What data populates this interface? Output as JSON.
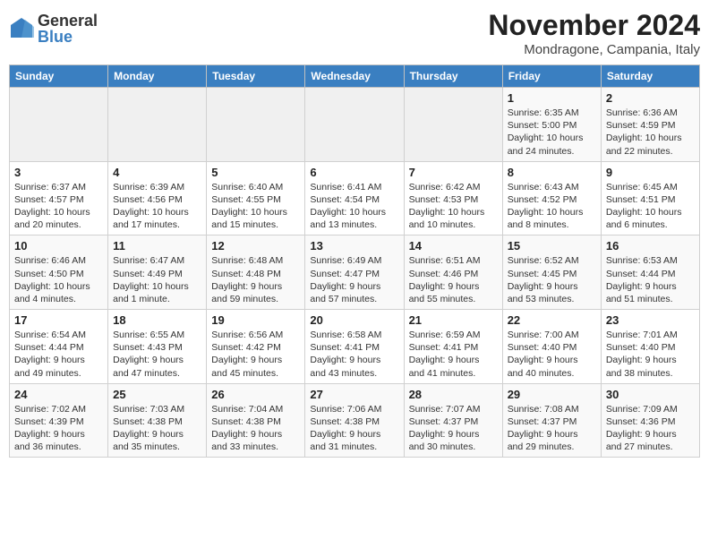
{
  "logo": {
    "general": "General",
    "blue": "Blue"
  },
  "title": "November 2024",
  "location": "Mondragone, Campania, Italy",
  "days_of_week": [
    "Sunday",
    "Monday",
    "Tuesday",
    "Wednesday",
    "Thursday",
    "Friday",
    "Saturday"
  ],
  "weeks": [
    [
      {
        "day": "",
        "info": ""
      },
      {
        "day": "",
        "info": ""
      },
      {
        "day": "",
        "info": ""
      },
      {
        "day": "",
        "info": ""
      },
      {
        "day": "",
        "info": ""
      },
      {
        "day": "1",
        "info": "Sunrise: 6:35 AM\nSunset: 5:00 PM\nDaylight: 10 hours and 24 minutes."
      },
      {
        "day": "2",
        "info": "Sunrise: 6:36 AM\nSunset: 4:59 PM\nDaylight: 10 hours and 22 minutes."
      }
    ],
    [
      {
        "day": "3",
        "info": "Sunrise: 6:37 AM\nSunset: 4:57 PM\nDaylight: 10 hours and 20 minutes."
      },
      {
        "day": "4",
        "info": "Sunrise: 6:39 AM\nSunset: 4:56 PM\nDaylight: 10 hours and 17 minutes."
      },
      {
        "day": "5",
        "info": "Sunrise: 6:40 AM\nSunset: 4:55 PM\nDaylight: 10 hours and 15 minutes."
      },
      {
        "day": "6",
        "info": "Sunrise: 6:41 AM\nSunset: 4:54 PM\nDaylight: 10 hours and 13 minutes."
      },
      {
        "day": "7",
        "info": "Sunrise: 6:42 AM\nSunset: 4:53 PM\nDaylight: 10 hours and 10 minutes."
      },
      {
        "day": "8",
        "info": "Sunrise: 6:43 AM\nSunset: 4:52 PM\nDaylight: 10 hours and 8 minutes."
      },
      {
        "day": "9",
        "info": "Sunrise: 6:45 AM\nSunset: 4:51 PM\nDaylight: 10 hours and 6 minutes."
      }
    ],
    [
      {
        "day": "10",
        "info": "Sunrise: 6:46 AM\nSunset: 4:50 PM\nDaylight: 10 hours and 4 minutes."
      },
      {
        "day": "11",
        "info": "Sunrise: 6:47 AM\nSunset: 4:49 PM\nDaylight: 10 hours and 1 minute."
      },
      {
        "day": "12",
        "info": "Sunrise: 6:48 AM\nSunset: 4:48 PM\nDaylight: 9 hours and 59 minutes."
      },
      {
        "day": "13",
        "info": "Sunrise: 6:49 AM\nSunset: 4:47 PM\nDaylight: 9 hours and 57 minutes."
      },
      {
        "day": "14",
        "info": "Sunrise: 6:51 AM\nSunset: 4:46 PM\nDaylight: 9 hours and 55 minutes."
      },
      {
        "day": "15",
        "info": "Sunrise: 6:52 AM\nSunset: 4:45 PM\nDaylight: 9 hours and 53 minutes."
      },
      {
        "day": "16",
        "info": "Sunrise: 6:53 AM\nSunset: 4:44 PM\nDaylight: 9 hours and 51 minutes."
      }
    ],
    [
      {
        "day": "17",
        "info": "Sunrise: 6:54 AM\nSunset: 4:44 PM\nDaylight: 9 hours and 49 minutes."
      },
      {
        "day": "18",
        "info": "Sunrise: 6:55 AM\nSunset: 4:43 PM\nDaylight: 9 hours and 47 minutes."
      },
      {
        "day": "19",
        "info": "Sunrise: 6:56 AM\nSunset: 4:42 PM\nDaylight: 9 hours and 45 minutes."
      },
      {
        "day": "20",
        "info": "Sunrise: 6:58 AM\nSunset: 4:41 PM\nDaylight: 9 hours and 43 minutes."
      },
      {
        "day": "21",
        "info": "Sunrise: 6:59 AM\nSunset: 4:41 PM\nDaylight: 9 hours and 41 minutes."
      },
      {
        "day": "22",
        "info": "Sunrise: 7:00 AM\nSunset: 4:40 PM\nDaylight: 9 hours and 40 minutes."
      },
      {
        "day": "23",
        "info": "Sunrise: 7:01 AM\nSunset: 4:40 PM\nDaylight: 9 hours and 38 minutes."
      }
    ],
    [
      {
        "day": "24",
        "info": "Sunrise: 7:02 AM\nSunset: 4:39 PM\nDaylight: 9 hours and 36 minutes."
      },
      {
        "day": "25",
        "info": "Sunrise: 7:03 AM\nSunset: 4:38 PM\nDaylight: 9 hours and 35 minutes."
      },
      {
        "day": "26",
        "info": "Sunrise: 7:04 AM\nSunset: 4:38 PM\nDaylight: 9 hours and 33 minutes."
      },
      {
        "day": "27",
        "info": "Sunrise: 7:06 AM\nSunset: 4:38 PM\nDaylight: 9 hours and 31 minutes."
      },
      {
        "day": "28",
        "info": "Sunrise: 7:07 AM\nSunset: 4:37 PM\nDaylight: 9 hours and 30 minutes."
      },
      {
        "day": "29",
        "info": "Sunrise: 7:08 AM\nSunset: 4:37 PM\nDaylight: 9 hours and 29 minutes."
      },
      {
        "day": "30",
        "info": "Sunrise: 7:09 AM\nSunset: 4:36 PM\nDaylight: 9 hours and 27 minutes."
      }
    ]
  ]
}
